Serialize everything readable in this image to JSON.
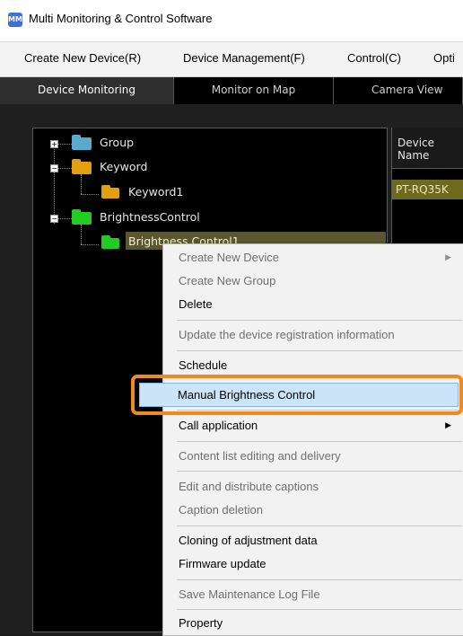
{
  "window": {
    "title": "Multi Monitoring & Control Software",
    "app_icon_text": "MM"
  },
  "menubar": {
    "items": [
      "Create New Device(R)",
      "Device Management(F)",
      "Control(C)",
      "Opti"
    ]
  },
  "tabs": [
    "Device Monitoring",
    "Monitor on Map",
    "Camera View"
  ],
  "tree": {
    "group": "Group",
    "keyword": "Keyword",
    "keyword1": "Keyword1",
    "brightness_control": "BrightnessControl",
    "brightness_child": "Brightness Control1"
  },
  "list": {
    "device_name_header_line1": "Device",
    "device_name_header_line2": "Name",
    "device_cell": "PT-RQ35K"
  },
  "context_menu": {
    "create_new_device": "Create New Device",
    "create_new_group": "Create New Group",
    "delete": "Delete",
    "update_registration": "Update the device registration information",
    "schedule": "Schedule",
    "manual_brightness": "Manual Brightness Control",
    "call_application": "Call application",
    "content_list": "Content list editing and delivery",
    "edit_captions": "Edit and distribute captions",
    "caption_deletion": "Caption deletion",
    "cloning": "Cloning of adjustment data",
    "firmware": "Firmware update",
    "save_log": "Save Maintenance Log File",
    "property": "Property"
  },
  "colors": {
    "highlight_border": "#f08a1e",
    "selected_item_bg": "#cce4f7"
  }
}
